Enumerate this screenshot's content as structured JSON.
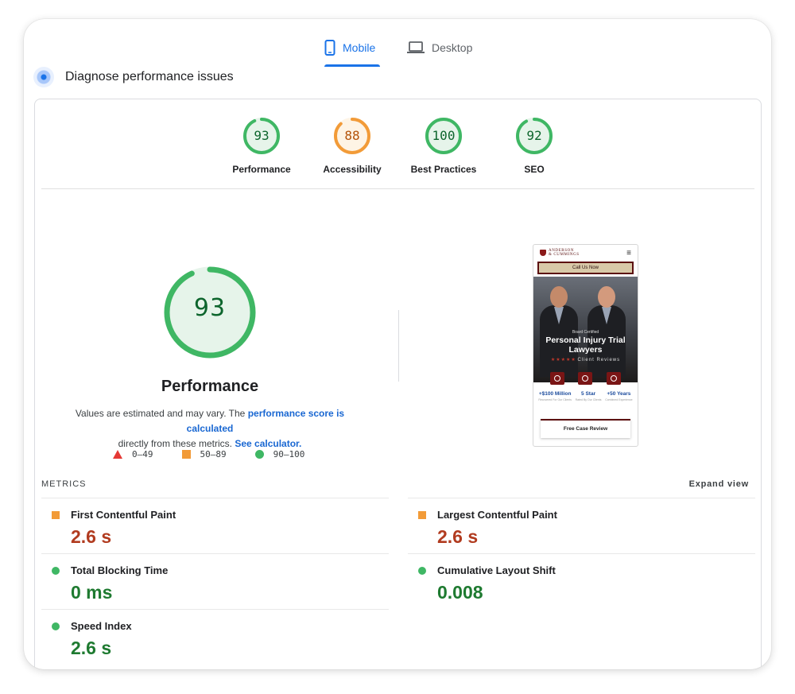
{
  "tabs": [
    {
      "label": "Mobile",
      "icon": "smartphone-icon",
      "active": true
    },
    {
      "label": "Desktop",
      "icon": "laptop-icon",
      "active": false
    }
  ],
  "diagnose": {
    "icon": "lighthouse-icon",
    "title": "Diagnose performance issues"
  },
  "categories": [
    {
      "label": "Performance",
      "score": "93",
      "score_value": 93,
      "color": "#3fb764"
    },
    {
      "label": "Accessibility",
      "score": "88",
      "score_value": 88,
      "color": "#f29b38"
    },
    {
      "label": "Best Practices",
      "score": "100",
      "score_value": 100,
      "color": "#3fb764"
    },
    {
      "label": "SEO",
      "score": "92",
      "score_value": 92,
      "color": "#3fb764"
    }
  ],
  "main": {
    "score": "93",
    "score_value": 93,
    "title": "Performance",
    "note_prefix": "Values are estimated and may vary. The ",
    "note_link1": "performance score is calculated",
    "note_mid": " directly from these metrics. ",
    "note_link2": "See calculator.",
    "legend": [
      {
        "shape": "triangle",
        "range": "0–49",
        "color": "#e53935"
      },
      {
        "shape": "square",
        "range": "50–89",
        "color": "#f29b38"
      },
      {
        "shape": "circle",
        "range": "90–100",
        "color": "#3fb764"
      }
    ]
  },
  "screenshot": {
    "logo_line1": "ANDERSON",
    "logo_line2": "& CUMMINGS",
    "cta": "Call Us Now",
    "eyebrow": "Board Certified",
    "headline": "Personal Injury Trial Lawyers",
    "reviews": "Client Reviews",
    "stats": [
      {
        "value": "+$100 Million",
        "caption": "Recovered For Our Clients"
      },
      {
        "value": "5 Star",
        "caption": "Rated By Our Clients"
      },
      {
        "value": "+50 Years",
        "caption": "Combined Experience"
      }
    ],
    "free_review": "Free Case Review"
  },
  "metrics": {
    "heading": "METRICS",
    "expand": "Expand view",
    "left": [
      {
        "label": "First Contentful Paint",
        "value": "2.6 s",
        "status": "orange"
      },
      {
        "label": "Total Blocking Time",
        "value": "0 ms",
        "status": "green"
      },
      {
        "label": "Speed Index",
        "value": "2.6 s",
        "status": "green"
      }
    ],
    "right": [
      {
        "label": "Largest Contentful Paint",
        "value": "2.6 s",
        "status": "orange"
      },
      {
        "label": "Cumulative Layout Shift",
        "value": "0.008",
        "status": "green"
      }
    ]
  },
  "colors": {
    "accent": "#1a73e8",
    "pass": "#3fb764",
    "average": "#f29b38",
    "fail": "#e53935"
  }
}
